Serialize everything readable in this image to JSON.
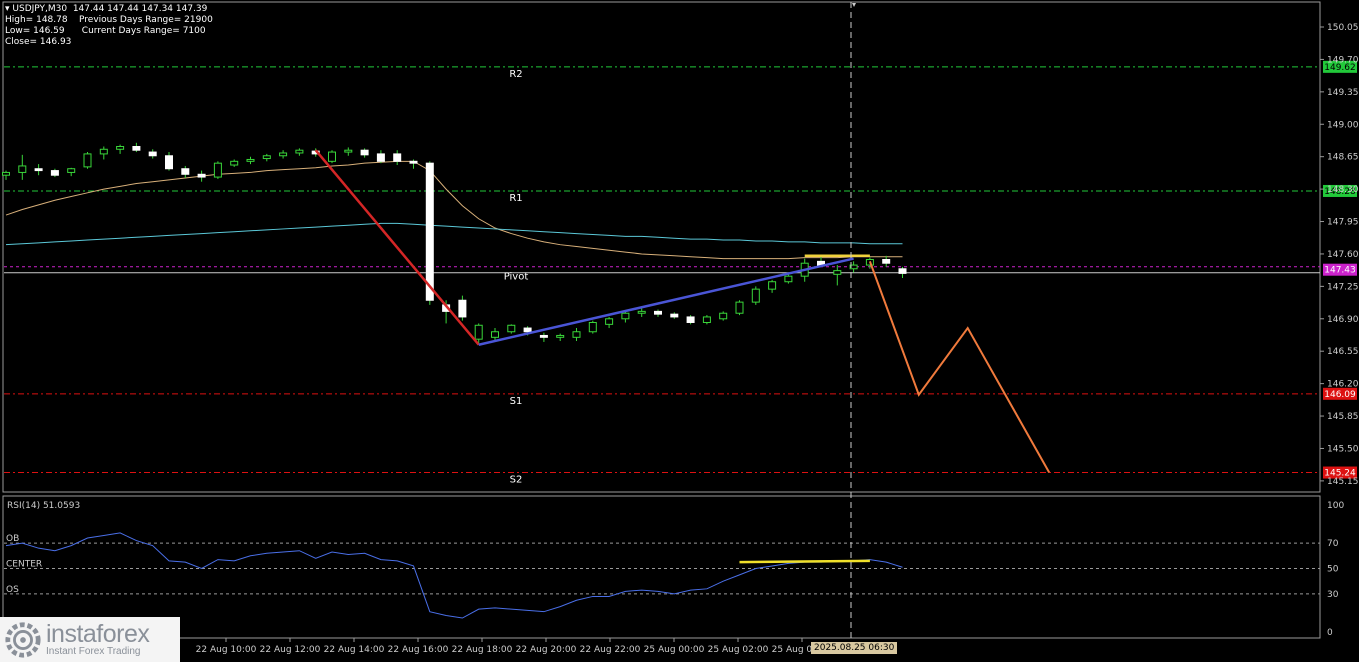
{
  "header": {
    "symbol": "USDJPY,M30",
    "ohlc": "147.44 147.44 147.34 147.39",
    "high": "High= 148.78",
    "prev_range": "Previous Days Range= 21900",
    "low": "Low= 146.59",
    "curr_range": "Current Days Range= 7100",
    "close": "Close= 146.93"
  },
  "levels": {
    "r2": {
      "label": "R2",
      "price": 149.62,
      "tag": "149.62",
      "color": "#22c93a"
    },
    "r1": {
      "label": "R1",
      "price": 148.28,
      "tag": "148.28",
      "color": "#22c93a"
    },
    "pivot": {
      "label": "Pivot",
      "price": 147.43,
      "tag": "147.43",
      "color": "#cc22cc"
    },
    "s1": {
      "label": "S1",
      "price": 146.09,
      "tag": "146.09",
      "color": "#dd1111"
    },
    "s2": {
      "label": "S2",
      "price": 145.24,
      "tag": "145.24",
      "color": "#dd1111"
    }
  },
  "rsi_panel": {
    "title": "RSI(14) 51.0593",
    "ob_label": "OB",
    "center_label": "CENTER",
    "os_label": "OS"
  },
  "logo": {
    "brand": "instaforex",
    "tagline": "Instant Forex Trading"
  },
  "time_badge": "2025.08.25 06:30",
  "chart_data": [
    {
      "type": "candlestick",
      "ylim": [
        145.03,
        150.32
      ],
      "y_ticks": [
        "150.05",
        "149.70",
        "149.35",
        "149.00",
        "148.65",
        "148.30",
        "147.95",
        "147.60",
        "147.25",
        "146.90",
        "146.55",
        "146.20",
        "145.85",
        "145.50",
        "145.15"
      ],
      "x_ticks": [
        "22 Aug 10:00",
        "22 Aug 12:00",
        "22 Aug 14:00",
        "22 Aug 16:00",
        "22 Aug 18:00",
        "22 Aug 20:00",
        "22 Aug 22:00",
        "25 Aug 00:00",
        "25 Aug 02:00",
        "25 Aug 04:00"
      ],
      "candles": [
        [
          148.45,
          148.5,
          148.4,
          148.48
        ],
        [
          148.48,
          148.67,
          148.4,
          148.55
        ],
        [
          148.52,
          148.57,
          148.45,
          148.5
        ],
        [
          148.5,
          148.52,
          148.43,
          148.45
        ],
        [
          148.48,
          148.53,
          148.44,
          148.52
        ],
        [
          148.54,
          148.7,
          148.52,
          148.68
        ],
        [
          148.68,
          148.76,
          148.62,
          148.73
        ],
        [
          148.73,
          148.78,
          148.68,
          148.76
        ],
        [
          148.76,
          148.8,
          148.7,
          148.72
        ],
        [
          148.7,
          148.73,
          148.63,
          148.66
        ],
        [
          148.66,
          148.7,
          148.5,
          148.52
        ],
        [
          148.52,
          148.55,
          148.42,
          148.46
        ],
        [
          148.46,
          148.5,
          148.38,
          148.43
        ],
        [
          148.43,
          148.6,
          148.41,
          148.58
        ],
        [
          148.56,
          148.62,
          148.54,
          148.6
        ],
        [
          148.6,
          148.65,
          148.57,
          148.62
        ],
        [
          148.63,
          148.68,
          148.6,
          148.66
        ],
        [
          148.66,
          148.72,
          148.63,
          148.69
        ],
        [
          148.69,
          148.74,
          148.66,
          148.72
        ],
        [
          148.71,
          148.74,
          148.65,
          148.68
        ],
        [
          148.6,
          148.72,
          148.58,
          148.7
        ],
        [
          148.7,
          148.75,
          148.66,
          148.72
        ],
        [
          148.72,
          148.74,
          148.64,
          148.67
        ],
        [
          148.68,
          148.72,
          148.58,
          148.6
        ],
        [
          148.68,
          148.72,
          148.56,
          148.6
        ],
        [
          148.6,
          148.62,
          148.52,
          148.58
        ],
        [
          148.58,
          148.6,
          147.05,
          147.1
        ],
        [
          147.05,
          147.1,
          146.85,
          146.98
        ],
        [
          147.1,
          147.15,
          146.88,
          146.92
        ],
        [
          146.68,
          146.85,
          146.62,
          146.83
        ],
        [
          146.7,
          146.8,
          146.65,
          146.76
        ],
        [
          146.76,
          146.84,
          146.74,
          146.83
        ],
        [
          146.8,
          146.82,
          146.72,
          146.76
        ],
        [
          146.72,
          146.75,
          146.65,
          146.7
        ],
        [
          146.7,
          146.74,
          146.66,
          146.72
        ],
        [
          146.7,
          146.8,
          146.66,
          146.76
        ],
        [
          146.76,
          146.88,
          146.74,
          146.86
        ],
        [
          146.84,
          146.92,
          146.8,
          146.9
        ],
        [
          146.9,
          146.98,
          146.86,
          146.96
        ],
        [
          146.96,
          147.02,
          146.92,
          146.98
        ],
        [
          146.98,
          147.0,
          146.92,
          146.95
        ],
        [
          146.95,
          146.97,
          146.9,
          146.92
        ],
        [
          146.92,
          146.94,
          146.84,
          146.86
        ],
        [
          146.86,
          146.94,
          146.84,
          146.92
        ],
        [
          146.9,
          146.98,
          146.88,
          146.96
        ],
        [
          146.96,
          147.1,
          146.94,
          147.08
        ],
        [
          147.08,
          147.25,
          147.05,
          147.22
        ],
        [
          147.22,
          147.32,
          147.18,
          147.3
        ],
        [
          147.3,
          147.4,
          147.28,
          147.36
        ],
        [
          147.36,
          147.55,
          147.3,
          147.5
        ],
        [
          147.52,
          147.58,
          147.46,
          147.47
        ],
        [
          147.38,
          147.48,
          147.26,
          147.42
        ],
        [
          147.44,
          147.52,
          147.4,
          147.48
        ],
        [
          147.48,
          147.56,
          147.44,
          147.54
        ],
        [
          147.54,
          147.58,
          147.46,
          147.5
        ],
        [
          147.44,
          147.46,
          147.34,
          147.39
        ]
      ],
      "moving_averages": [
        {
          "color": "#d8b07a",
          "values": [
            148.02,
            148.08,
            148.13,
            148.18,
            148.22,
            148.26,
            148.3,
            148.33,
            148.36,
            148.38,
            148.4,
            148.42,
            148.44,
            148.46,
            148.47,
            148.48,
            148.5,
            148.51,
            148.52,
            148.53,
            148.55,
            148.56,
            148.58,
            148.59,
            148.6,
            148.6,
            148.5,
            148.3,
            148.12,
            147.98,
            147.88,
            147.82,
            147.77,
            147.73,
            147.7,
            147.68,
            147.66,
            147.64,
            147.62,
            147.6,
            147.59,
            147.58,
            147.57,
            147.56,
            147.55,
            147.55,
            147.55,
            147.55,
            147.55,
            147.56,
            147.56,
            147.56,
            147.57,
            147.57,
            147.57,
            147.57
          ]
        },
        {
          "color": "#5bc8d8",
          "values": [
            147.7,
            147.71,
            147.72,
            147.73,
            147.74,
            147.75,
            147.76,
            147.77,
            147.78,
            147.79,
            147.8,
            147.81,
            147.82,
            147.83,
            147.84,
            147.85,
            147.86,
            147.87,
            147.88,
            147.89,
            147.9,
            147.91,
            147.92,
            147.93,
            147.93,
            147.92,
            147.91,
            147.9,
            147.89,
            147.88,
            147.87,
            147.86,
            147.85,
            147.84,
            147.83,
            147.82,
            147.81,
            147.8,
            147.79,
            147.79,
            147.78,
            147.77,
            147.76,
            147.76,
            147.75,
            147.75,
            147.74,
            147.74,
            147.73,
            147.73,
            147.72,
            147.72,
            147.72,
            147.71,
            147.71,
            147.71
          ]
        }
      ],
      "trend_lines": [
        {
          "color": "#d42626",
          "points": [
            [
              19,
              148.72
            ],
            [
              29,
              146.62
            ]
          ]
        },
        {
          "color": "#4a55d6",
          "points": [
            [
              29,
              146.62
            ],
            [
              52,
              147.55
            ]
          ]
        },
        {
          "color": "#f0d23c",
          "points": [
            [
              49,
              147.58
            ],
            [
              53,
              147.58
            ]
          ]
        }
      ],
      "forecast_path": {
        "color": "#f07a3c",
        "points": [
          [
            53,
            147.52
          ],
          [
            56,
            146.08
          ],
          [
            59,
            146.8
          ],
          [
            64,
            145.24
          ]
        ]
      }
    },
    {
      "type": "line",
      "name": "RSI(14)",
      "ylim": [
        0,
        100
      ],
      "y_ticks": [
        "100",
        "70",
        "50",
        "30",
        "0"
      ],
      "levels": [
        70,
        50,
        30
      ],
      "values": [
        68,
        70,
        66,
        64,
        68,
        74,
        76,
        78,
        72,
        68,
        56,
        55,
        50,
        57,
        56,
        60,
        62,
        63,
        64,
        58,
        63,
        61,
        62,
        57,
        56,
        52,
        16,
        13,
        11,
        18,
        19,
        18,
        17,
        16,
        20,
        25,
        28,
        28,
        32,
        33,
        32,
        30,
        33,
        34,
        40,
        45,
        50,
        52,
        54,
        55,
        55,
        56,
        56,
        57,
        55,
        51
      ],
      "highlight": {
        "color": "#f0e02a",
        "from": 45,
        "to": 53,
        "values": [
          55,
          56
        ]
      }
    }
  ]
}
